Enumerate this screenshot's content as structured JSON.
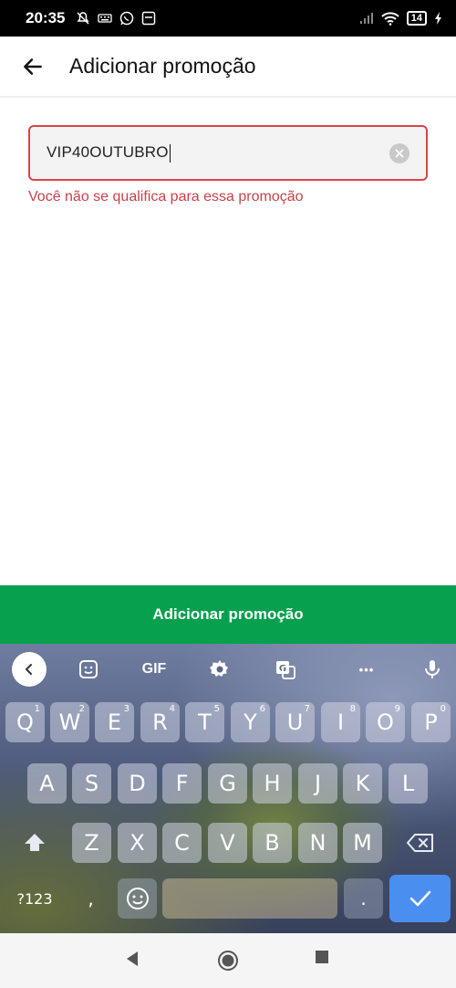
{
  "status_bar": {
    "time": "20:35",
    "battery": "14",
    "icons": [
      "mute-icon",
      "keyboard-icon",
      "whatsapp-icon",
      "notification-icon",
      "signal-icon",
      "wifi-icon",
      "battery-icon",
      "charging-icon"
    ]
  },
  "header": {
    "title": "Adicionar promoção",
    "back_icon": "arrow-left-icon"
  },
  "promo": {
    "value": "VIP40OUTUBRO",
    "error": "Você não se qualifica para essa promoção",
    "clear_icon": "clear-icon"
  },
  "actions": {
    "add_label": "Adicionar promoção"
  },
  "keyboard": {
    "toolbar": {
      "gif_label": "GIF",
      "more_label": "•••"
    },
    "row1": [
      {
        "key": "Q",
        "hint": "1"
      },
      {
        "key": "W",
        "hint": "2"
      },
      {
        "key": "E",
        "hint": "3"
      },
      {
        "key": "R",
        "hint": "4"
      },
      {
        "key": "T",
        "hint": "5"
      },
      {
        "key": "Y",
        "hint": "6"
      },
      {
        "key": "U",
        "hint": "7"
      },
      {
        "key": "I",
        "hint": "8"
      },
      {
        "key": "O",
        "hint": "9"
      },
      {
        "key": "P",
        "hint": "0"
      }
    ],
    "row2": [
      "A",
      "S",
      "D",
      "F",
      "G",
      "H",
      "J",
      "K",
      "L"
    ],
    "row3": [
      "Z",
      "X",
      "C",
      "V",
      "B",
      "N",
      "M"
    ],
    "bottom": {
      "symbols_label": "?123",
      "comma_label": ",",
      "period_label": "."
    },
    "colors": {
      "enter_key": "#4a8ff0"
    }
  },
  "colors": {
    "primary_green": "#06a04e",
    "error_red": "#c6424a"
  }
}
